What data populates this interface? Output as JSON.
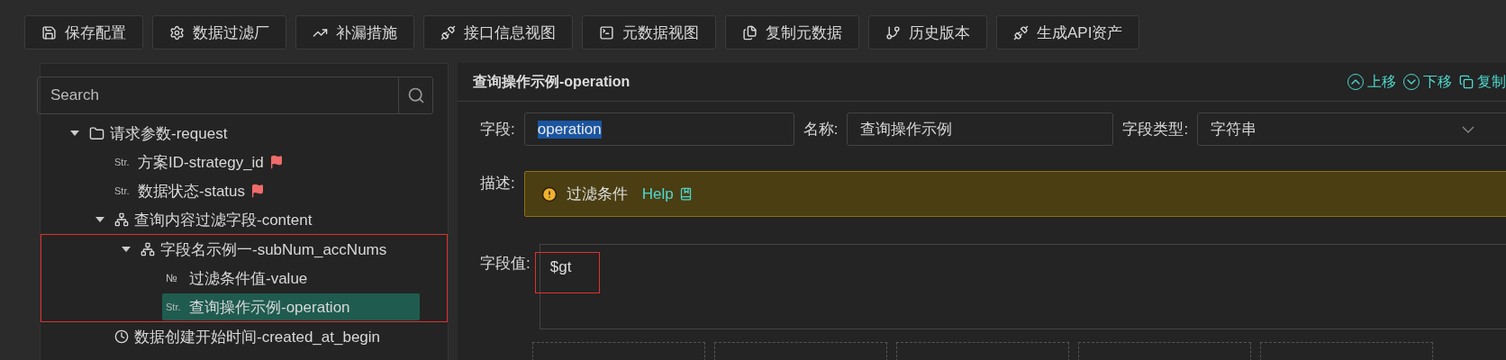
{
  "toolbar": [
    {
      "label": "保存配置"
    },
    {
      "label": "数据过滤厂"
    },
    {
      "label": "补漏措施"
    },
    {
      "label": "接口信息视图"
    },
    {
      "label": "元数据视图"
    },
    {
      "label": "复制元数据"
    },
    {
      "label": "历史版本"
    },
    {
      "label": "生成API资产"
    }
  ],
  "sidebar": {
    "search": {
      "placeholder": "Search"
    },
    "tree": [
      {
        "label": "请求参数-request",
        "kind": "folder",
        "expanded": true,
        "selected": false,
        "children": [
          {
            "label": "方案ID-strategy_id",
            "kind": "str",
            "tag": "Str.",
            "flagged": true,
            "selected": false
          },
          {
            "label": "数据状态-status",
            "kind": "str",
            "tag": "Str.",
            "flagged": true,
            "selected": false
          },
          {
            "label": "查询内容过滤字段-content",
            "kind": "object",
            "expanded": true,
            "selected": false,
            "children": [
              {
                "label": "字段名示例一-subNum_accNums",
                "kind": "object",
                "expanded": true,
                "selected": false,
                "highlighted": true,
                "children": [
                  {
                    "label": "过滤条件值-value",
                    "kind": "num",
                    "tag": "№",
                    "selected": false
                  },
                  {
                    "label": "查询操作示例-operation",
                    "kind": "str",
                    "tag": "Str.",
                    "selected": true
                  }
                ]
              }
            ]
          },
          {
            "label": "数据创建开始时间-created_at_begin",
            "kind": "time",
            "selected": false
          }
        ]
      }
    ]
  },
  "detail": {
    "title": "查询操作示例-operation",
    "actions": [
      {
        "label": "上移"
      },
      {
        "label": "下移"
      },
      {
        "label": "复制"
      }
    ],
    "field": {
      "label": "字段:",
      "value": "operation",
      "selected": true
    },
    "name": {
      "label": "名称:",
      "value": "查询操作示例"
    },
    "type": {
      "label": "字段类型:",
      "value": "字符串"
    },
    "description": {
      "label": "描述:",
      "text": "过滤条件",
      "link": "Help"
    },
    "field_value": {
      "label": "字段值:",
      "value": "$gt",
      "highlighted": true
    }
  }
}
